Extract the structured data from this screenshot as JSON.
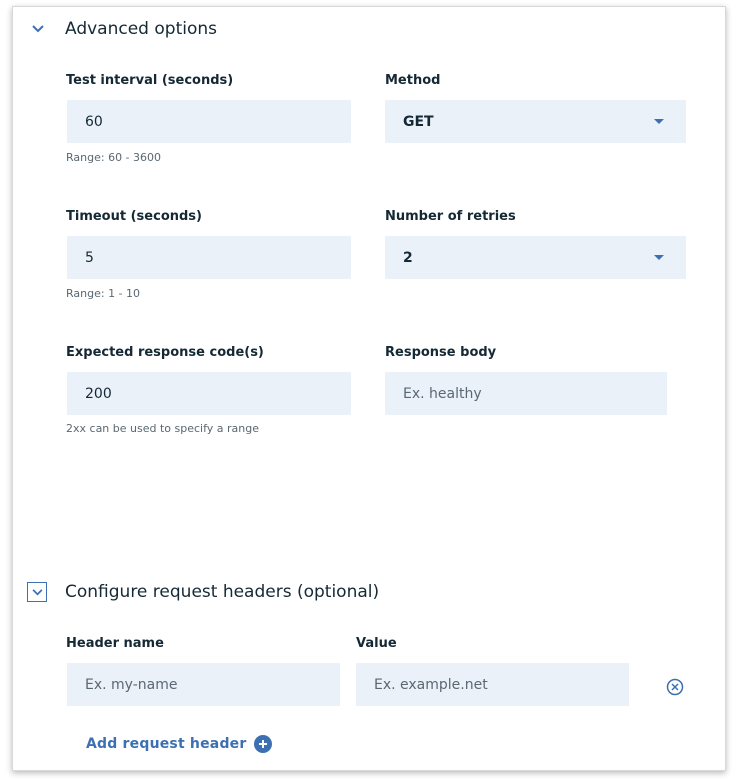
{
  "advanced": {
    "title": "Advanced options",
    "test_interval": {
      "label": "Test interval (seconds)",
      "value": "60",
      "helper": "Range: 60 - 3600"
    },
    "method": {
      "label": "Method",
      "value": "GET"
    },
    "timeout": {
      "label": "Timeout (seconds)",
      "value": "5",
      "helper": "Range: 1 - 10"
    },
    "retries": {
      "label": "Number of retries",
      "value": "2"
    },
    "expected_codes": {
      "label": "Expected response code(s)",
      "value": "200",
      "helper": "2xx can be used to specify a range"
    },
    "response_body": {
      "label": "Response body",
      "placeholder": "Ex. healthy"
    }
  },
  "headers": {
    "title": "Configure request headers (optional)",
    "name_label": "Header name",
    "value_label": "Value",
    "name_placeholder": "Ex. my-name",
    "value_placeholder": "Ex. example.net",
    "add_label": "Add request header"
  },
  "colors": {
    "accent": "#3d70b2",
    "field_bg": "#eaf1f9",
    "text": "#152935",
    "helper": "#5a6872"
  },
  "icons": [
    "chevron-down-icon",
    "dropdown-caret-icon",
    "remove-circle-icon",
    "add-circle-icon"
  ]
}
